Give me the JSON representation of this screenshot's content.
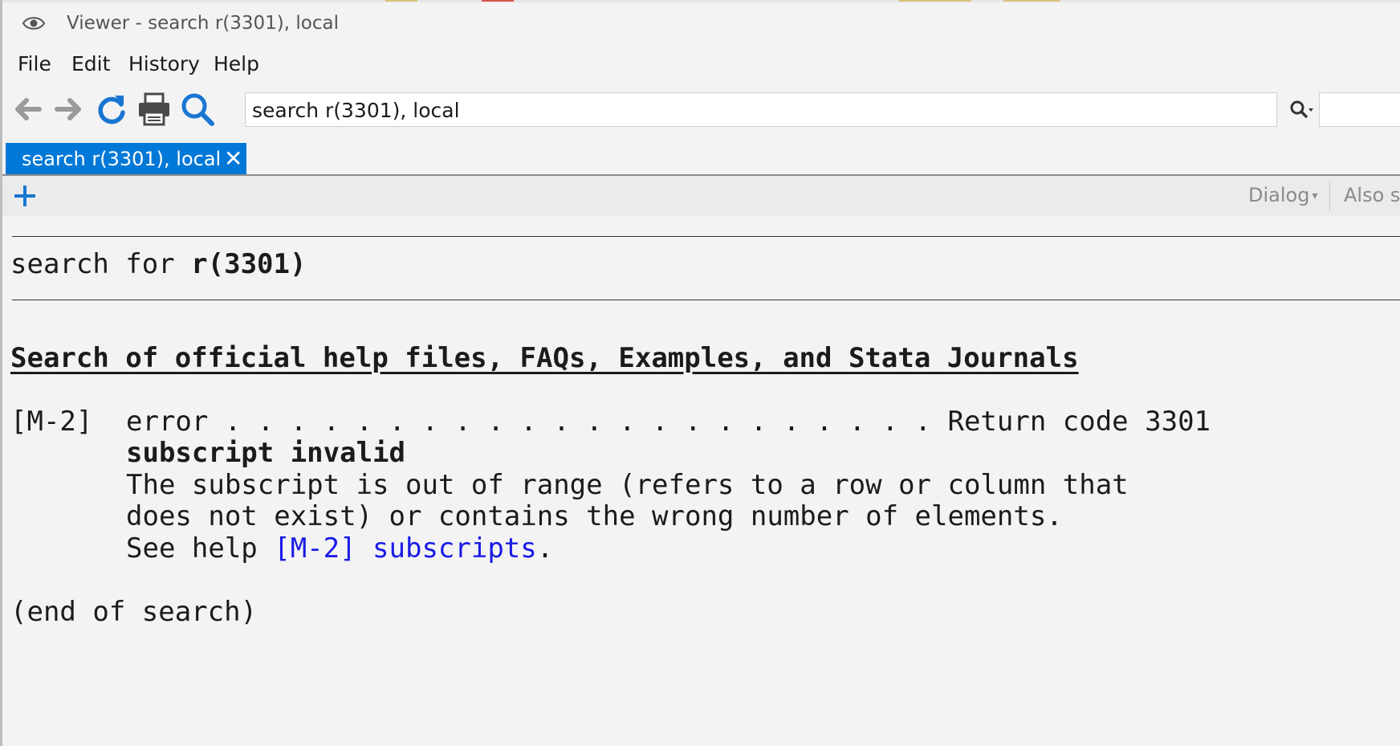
{
  "window": {
    "title": "Viewer - search r(3301), local"
  },
  "menu": {
    "file": "File",
    "edit": "Edit",
    "history": "History",
    "help": "Help"
  },
  "toolbar": {
    "address_value": "search r(3301), local"
  },
  "tab": {
    "label": "search r(3301), local",
    "close": "✕"
  },
  "subbar": {
    "dialog_label": "Dialog",
    "also_see_label": "Also s"
  },
  "content": {
    "search_prefix": "search for ",
    "search_term": "r(3301)",
    "section_heading": "Search of official help files, FAQs, Examples, and Stata Journals",
    "entry": {
      "tag": "[M-2]",
      "line1": "error . . . . . . . . . . . . . . . . . . . . . . Return code 3301",
      "line2": "subscript invalid",
      "line3": "The subscript is out of range (refers to a row or column that",
      "line4": "does not exist) or contains the wrong number of elements.",
      "see_prefix": "See help ",
      "see_link": "[M-2] subscripts",
      "see_suffix": "."
    },
    "end_text": "(end of search)"
  },
  "colors": {
    "accent": "#0078d7",
    "link": "#1a1ae6",
    "icon_blue": "#1976d2"
  }
}
